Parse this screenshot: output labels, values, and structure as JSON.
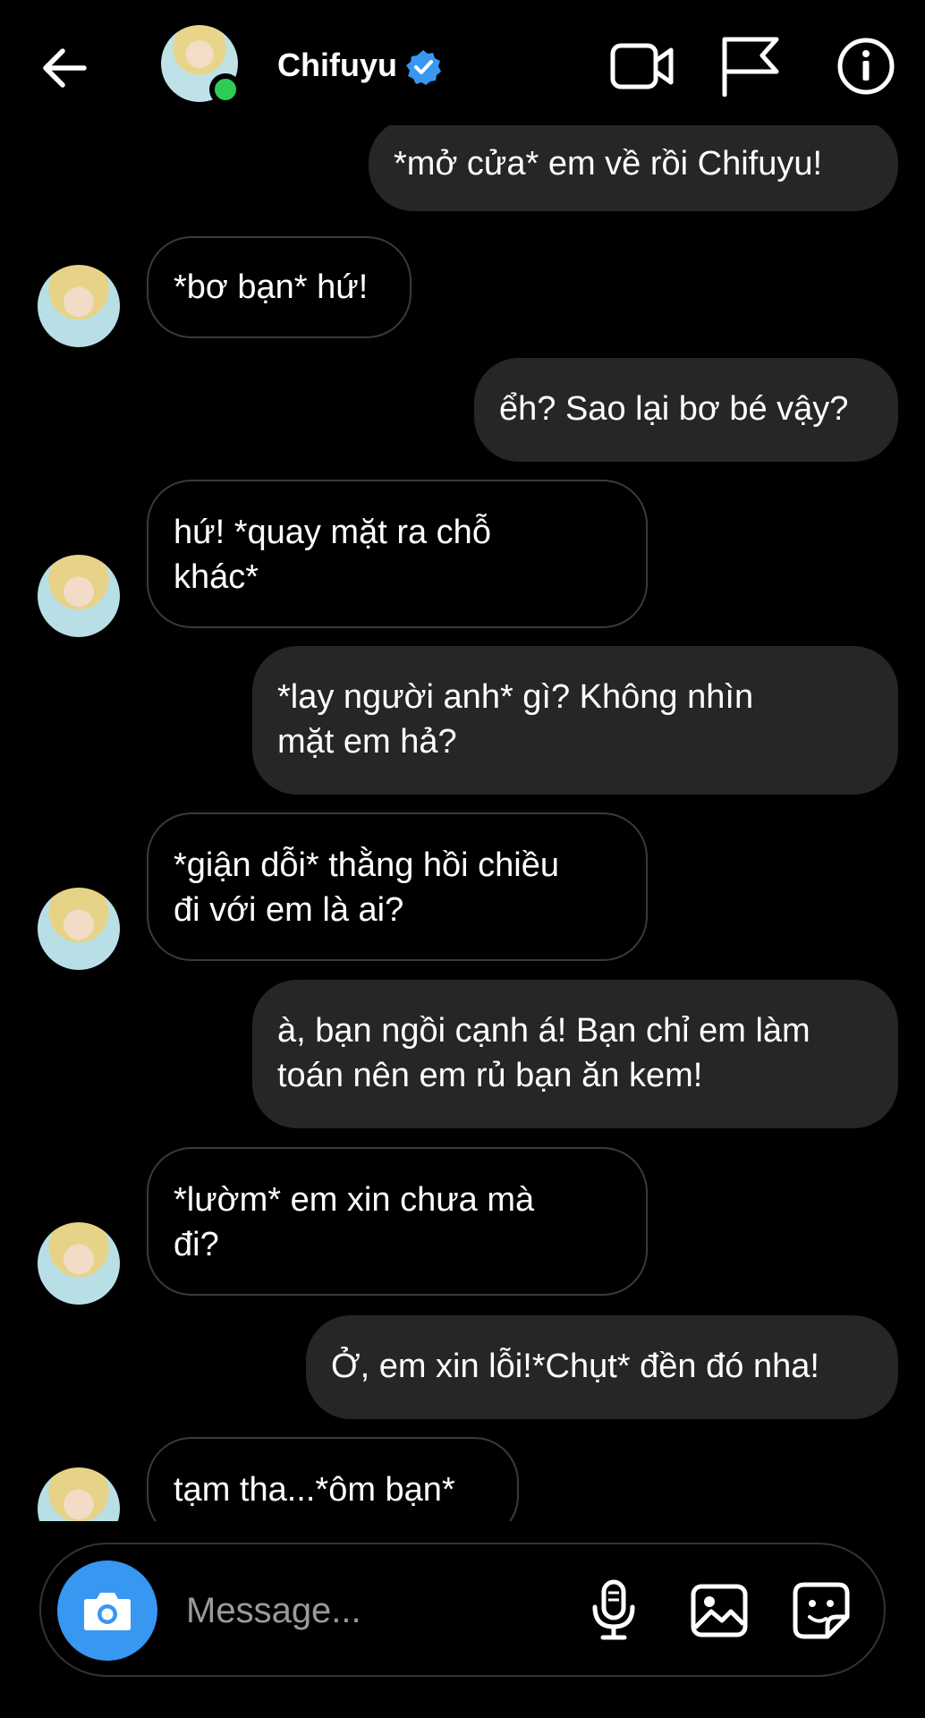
{
  "header": {
    "name": "Chifuyu",
    "icons": [
      "back-arrow-icon",
      "verified-badge-icon",
      "video-call-icon",
      "flag-icon",
      "info-icon"
    ],
    "online_color": "#2ecc55",
    "verified_color": "#3897f0"
  },
  "messages": [
    {
      "from": "me",
      "text": "*mở cửa* em về rồi Chifuyu!"
    },
    {
      "from": "them",
      "text": "*bơ bạn* hứ!"
    },
    {
      "from": "me",
      "text": "ểh? Sao lại bơ bé vậy?"
    },
    {
      "from": "them",
      "text": "hứ! *quay mặt ra chỗ\nkhác*"
    },
    {
      "from": "me",
      "text": "*lay người anh* gì? Không nhìn\nmặt em hả?"
    },
    {
      "from": "them",
      "text": "*giận dỗi* thằng hồi chiều\nđi với em là ai?"
    },
    {
      "from": "me",
      "text": "à, bạn ngồi cạnh á! Bạn chỉ em làm\ntoán nên em rủ bạn ăn kem!"
    },
    {
      "from": "them",
      "text": "*lườm* em xin chưa mà\nđi?"
    },
    {
      "from": "me",
      "text": "Ở, em xin lỗi!*Chụt* đền đó nha!"
    },
    {
      "from": "them",
      "text": "tạm tha...*ôm bạn*"
    }
  ],
  "composer": {
    "placeholder": "Message...",
    "icons": [
      "camera-icon",
      "microphone-icon",
      "gallery-icon",
      "sticker-icon"
    ],
    "camera_color": "#3897f0"
  },
  "colors": {
    "background": "#000000",
    "outgoing_bubble": "#262626",
    "incoming_border": "#3a3a3a"
  }
}
